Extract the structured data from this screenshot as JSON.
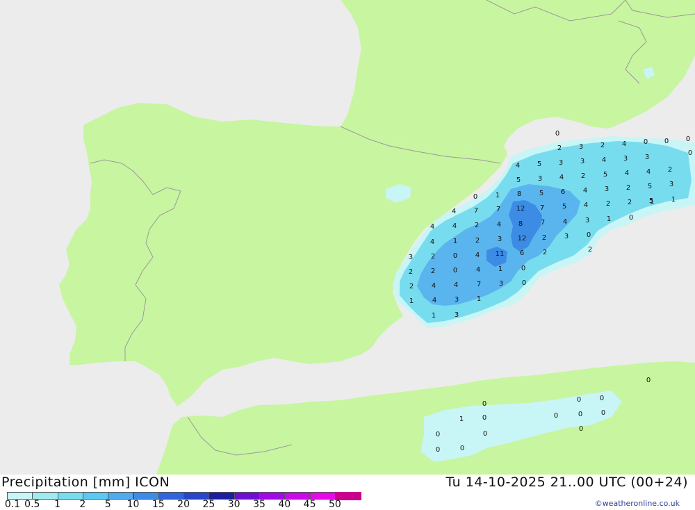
{
  "title": "Precipitation [mm] ICON",
  "datetime": "Tu 14-10-2025 21..00 UTC (00+24)",
  "credit": "©weatheronline.co.uk",
  "colors": {
    "sea": "#ececec",
    "land": "#c8f5a0",
    "border": "#9a9a9a",
    "rain_light": "#c8f5f5",
    "rain_mid": "#78dcef",
    "rain_high": "#5ab4ee",
    "rain_heavy": "#3c8ce6"
  },
  "legend": {
    "labels": [
      "0.1",
      "0.5",
      "1",
      "2",
      "5",
      "10",
      "15",
      "20",
      "25",
      "30",
      "35",
      "40",
      "45",
      "50"
    ],
    "colors": [
      "#c8f5f5",
      "#a0ebf0",
      "#78dcef",
      "#5ac8f0",
      "#50aaee",
      "#3c8ce6",
      "#3264dc",
      "#2846c8",
      "#1e1ea0",
      "#6e10d2",
      "#a00ae6",
      "#c80ae6",
      "#e60ae6",
      "#c8008c"
    ]
  },
  "values": [
    "0",
    "2",
    "3",
    "2",
    "4",
    "0",
    "0",
    "0",
    "0",
    "4",
    "5",
    "3",
    "3",
    "4",
    "3",
    "3",
    "2",
    "5",
    "3",
    "4",
    "2",
    "5",
    "4",
    "4",
    "3",
    "5",
    "0",
    "1",
    "8",
    "5",
    "6",
    "4",
    "3",
    "2",
    "5",
    "1",
    "4",
    "7",
    "7",
    "12",
    "7",
    "5",
    "4",
    "2",
    "2",
    "1",
    "4",
    "4",
    "2",
    "4",
    "8",
    "7",
    "4",
    "3",
    "1",
    "0",
    "4",
    "1",
    "2",
    "3",
    "12",
    "2",
    "3",
    "0",
    "3",
    "2",
    "0",
    "4",
    "11",
    "6",
    "2",
    "2",
    "2",
    "2",
    "0",
    "4",
    "1",
    "0",
    "2",
    "4",
    "4",
    "7",
    "3",
    "0",
    "1",
    "4",
    "3",
    "1",
    "1",
    "3",
    "0",
    "0",
    "0",
    "0",
    "1",
    "0",
    "0",
    "0",
    "0",
    "0",
    "0",
    "0",
    "0",
    "0"
  ]
}
